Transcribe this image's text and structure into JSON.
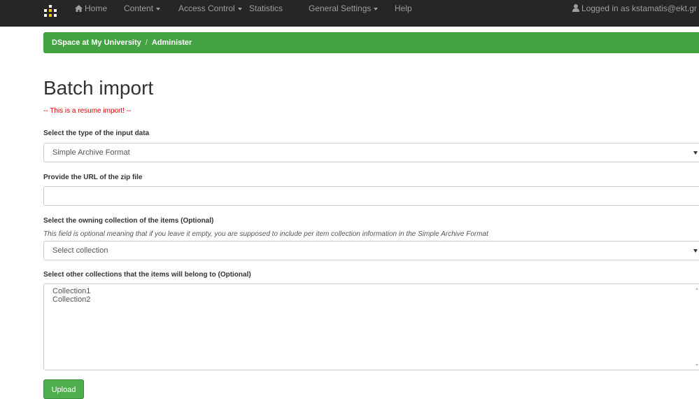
{
  "navbar": {
    "items": [
      {
        "label": "Home"
      },
      {
        "label": "Content"
      },
      {
        "label": "Access Control"
      },
      {
        "label": "Statistics"
      },
      {
        "label": "General Settings"
      },
      {
        "label": "Help"
      }
    ],
    "user_text": "Logged in as kstamatis@ekt.gr"
  },
  "breadcrumb": {
    "items": [
      "DSpace at My University",
      "Administer"
    ],
    "separator": "/"
  },
  "page": {
    "title": "Batch import",
    "notice": "-- This is a resume import! --"
  },
  "form": {
    "input_type": {
      "label": "Select the type of the input data",
      "selected": "Simple Archive Format"
    },
    "zip_url": {
      "label": "Provide the URL of the zip file",
      "value": ""
    },
    "owning_collection": {
      "label": "Select the owning collection of the items  (Optional)",
      "help": "This field is optional meaning that if you leave it empty, you are supposed to include per item collection information in the Simple Archive Format",
      "selected": "Select collection"
    },
    "other_collections": {
      "label": "Select other collections that the items will belong to (Optional)",
      "options": [
        "Collection1",
        "Collection2"
      ]
    },
    "upload_label": "Upload"
  },
  "colors": {
    "navbar_bg": "#262626",
    "nav_text": "#9d9d9d",
    "breadcrumb_bg": "#43a343",
    "notice_text": "#e00000",
    "button_bg": "#4cae4c"
  },
  "icons": {
    "brand": "dspace-logo-icon",
    "home": "home-icon",
    "user": "user-icon",
    "dropdown": "caret-down-icon"
  }
}
